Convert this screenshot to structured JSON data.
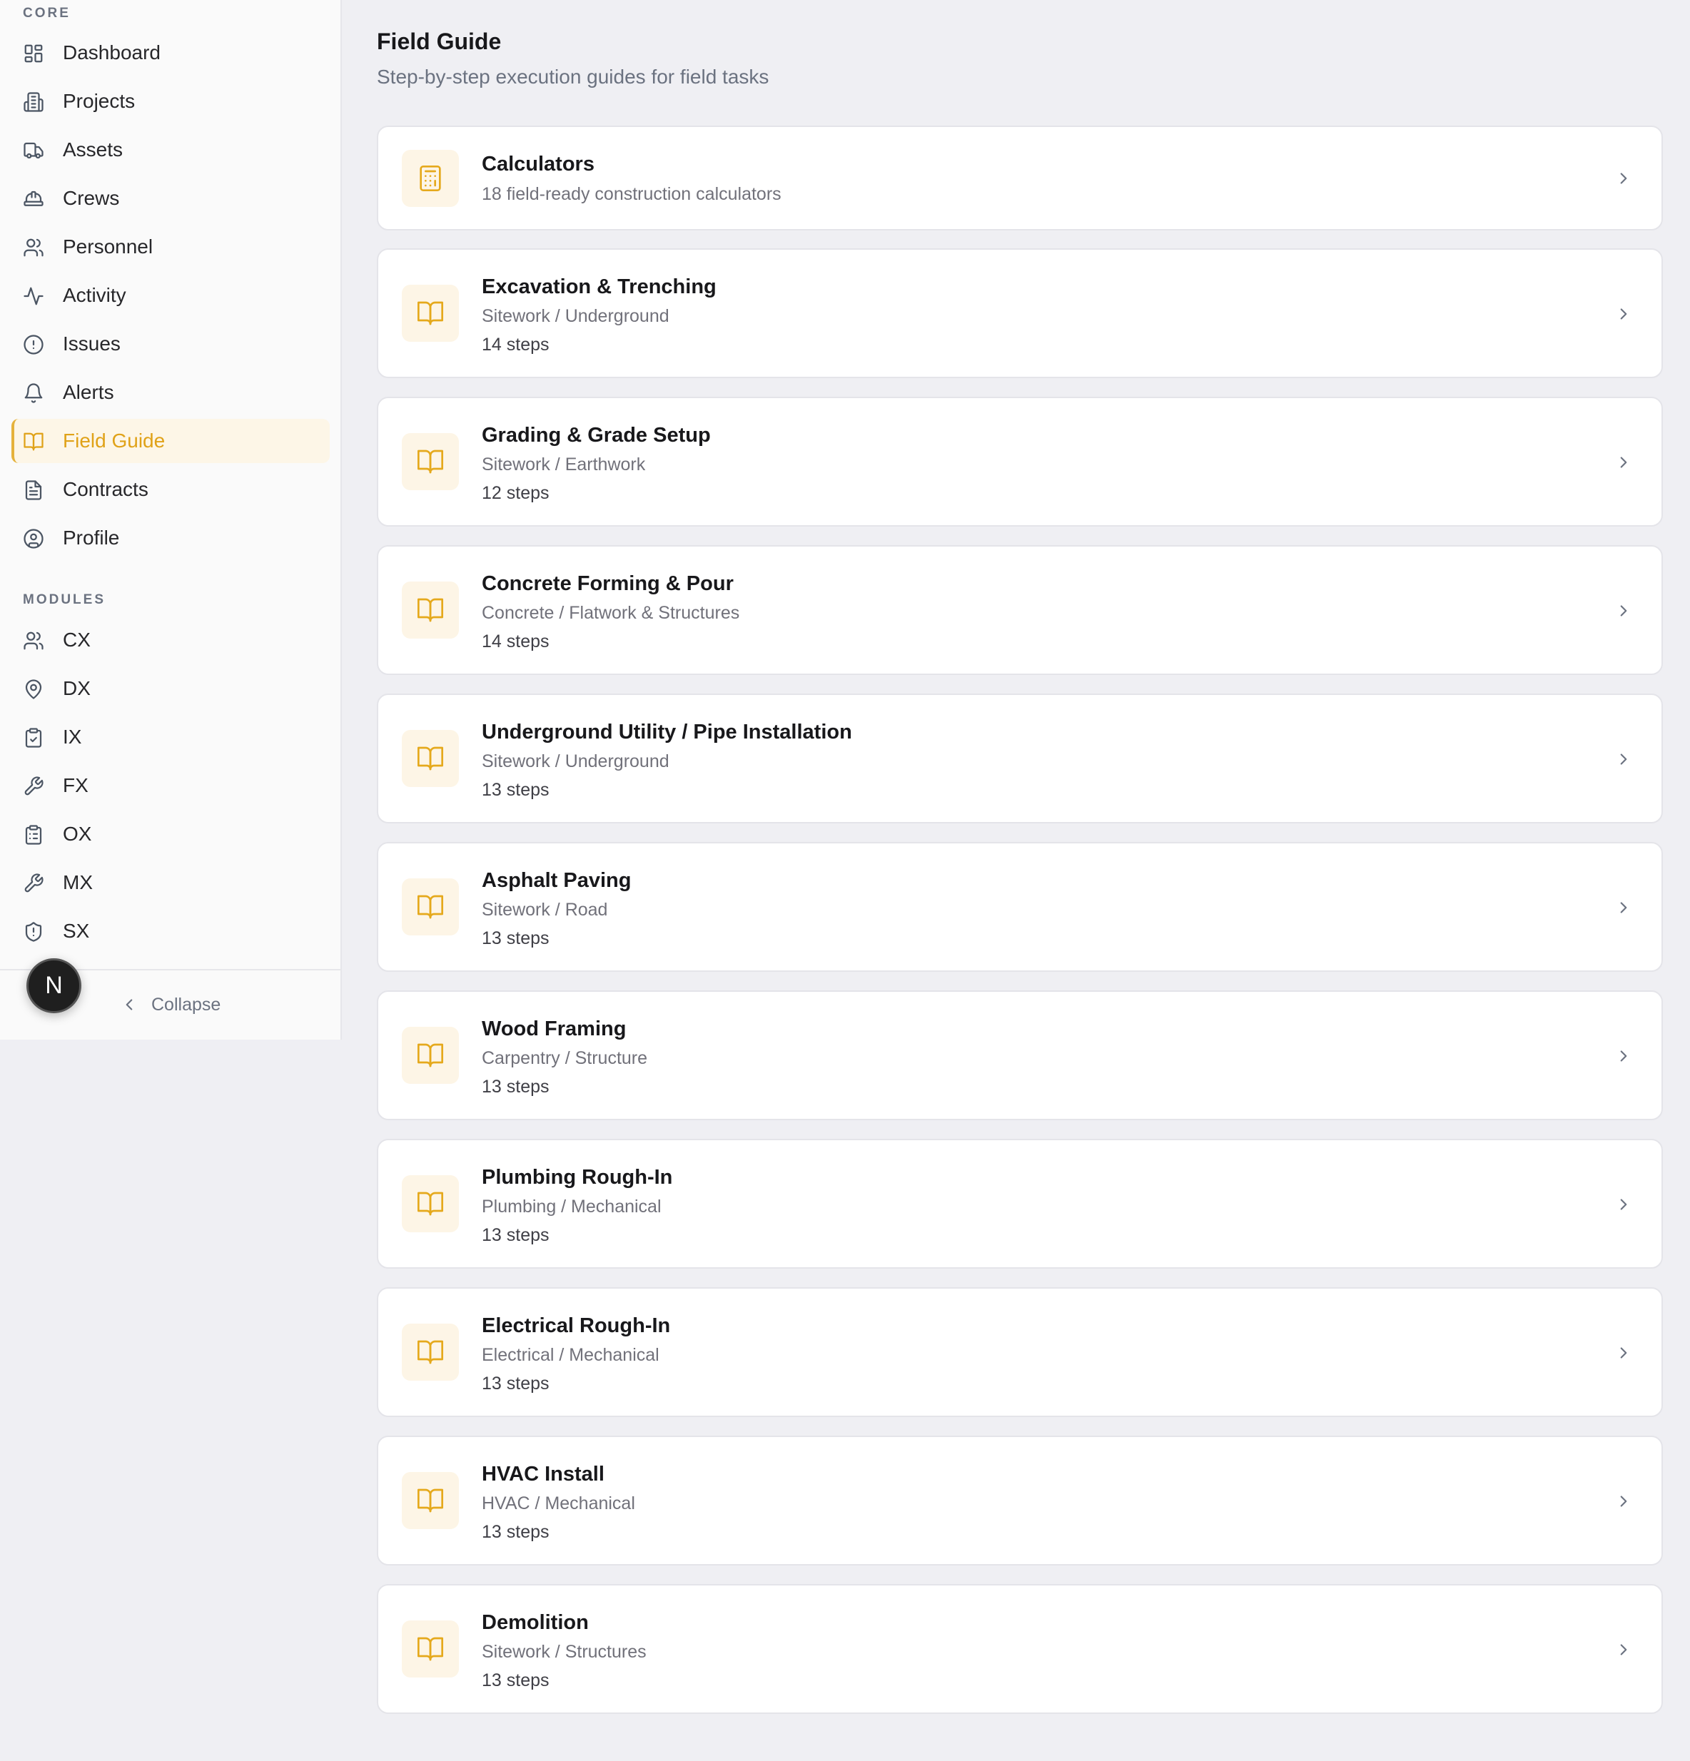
{
  "sidebar": {
    "core_label": "CORE",
    "core_items": [
      {
        "label": "Dashboard",
        "icon": "dashboard-icon"
      },
      {
        "label": "Projects",
        "icon": "building-icon"
      },
      {
        "label": "Assets",
        "icon": "truck-icon"
      },
      {
        "label": "Crews",
        "icon": "hard-hat-icon"
      },
      {
        "label": "Personnel",
        "icon": "users-icon"
      },
      {
        "label": "Activity",
        "icon": "activity-icon"
      },
      {
        "label": "Issues",
        "icon": "alert-circle-icon"
      },
      {
        "label": "Alerts",
        "icon": "bell-icon"
      },
      {
        "label": "Field Guide",
        "icon": "book-open-icon",
        "active": true
      },
      {
        "label": "Contracts",
        "icon": "file-text-icon"
      },
      {
        "label": "Profile",
        "icon": "user-circle-icon"
      }
    ],
    "modules_label": "MODULES",
    "module_items": [
      {
        "label": "CX",
        "icon": "users-icon"
      },
      {
        "label": "DX",
        "icon": "map-pin-icon"
      },
      {
        "label": "IX",
        "icon": "clipboard-check-icon"
      },
      {
        "label": "FX",
        "icon": "wrench-icon"
      },
      {
        "label": "OX",
        "icon": "clipboard-list-icon"
      },
      {
        "label": "MX",
        "icon": "wrench-icon"
      },
      {
        "label": "SX",
        "icon": "shield-alert-icon"
      }
    ],
    "avatar_letter": "N",
    "collapse_label": "Collapse"
  },
  "main": {
    "title": "Field Guide",
    "subtitle": "Step-by-step execution guides for field tasks",
    "calculators": {
      "title": "Calculators",
      "subtitle": "18 field-ready construction calculators",
      "icon": "calculator-icon"
    },
    "guides": [
      {
        "title": "Excavation & Trenching",
        "category": "Sitework / Underground",
        "steps": "14 steps"
      },
      {
        "title": "Grading & Grade Setup",
        "category": "Sitework / Earthwork",
        "steps": "12 steps"
      },
      {
        "title": "Concrete Forming & Pour",
        "category": "Concrete / Flatwork & Structures",
        "steps": "14 steps"
      },
      {
        "title": "Underground Utility / Pipe Installation",
        "category": "Sitework / Underground",
        "steps": "13 steps"
      },
      {
        "title": "Asphalt Paving",
        "category": "Sitework / Road",
        "steps": "13 steps"
      },
      {
        "title": "Wood Framing",
        "category": "Carpentry / Structure",
        "steps": "13 steps"
      },
      {
        "title": "Plumbing Rough-In",
        "category": "Plumbing / Mechanical",
        "steps": "13 steps"
      },
      {
        "title": "Electrical Rough-In",
        "category": "Electrical / Mechanical",
        "steps": "13 steps"
      },
      {
        "title": "HVAC Install",
        "category": "HVAC / Mechanical",
        "steps": "13 steps"
      },
      {
        "title": "Demolition",
        "category": "Sitework / Structures",
        "steps": "13 steps"
      }
    ],
    "guide_icon": "book-open-icon"
  },
  "colors": {
    "accent": "#E0A218",
    "accent_bg": "#FDF5E6",
    "page_bg": "#EFEFF3",
    "sidebar_bg": "#FAFAFA"
  }
}
